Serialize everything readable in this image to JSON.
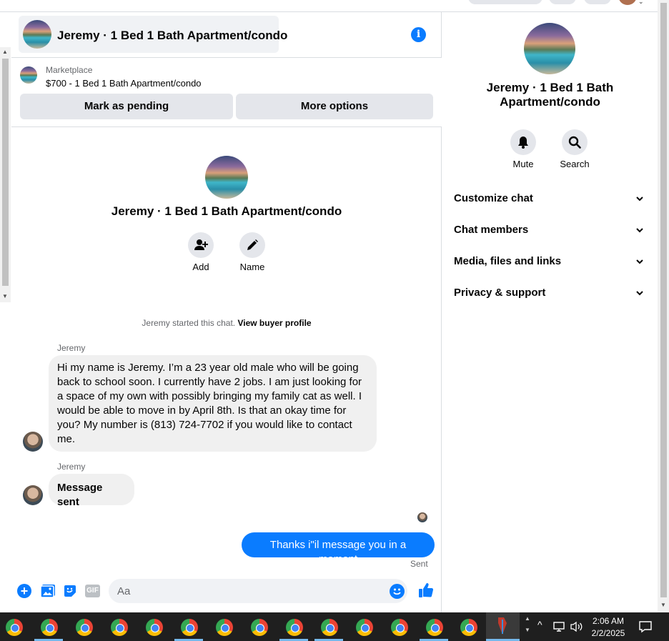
{
  "header": {
    "title": "Jeremy · 1 Bed 1 Bath Apartment/condo"
  },
  "marketplace": {
    "label": "Marketplace",
    "listing": "$700 - 1 Bed 1 Bath Apartment/condo",
    "mark_pending": "Mark as pending",
    "more_options": "More options"
  },
  "intro": {
    "name": "Jeremy · 1 Bed 1 Bath Apartment/condo",
    "add_label": "Add",
    "name_label": "Name",
    "started_text": "Jeremy started this chat.",
    "view_profile": "View buyer profile"
  },
  "messages": [
    {
      "sender": "Jeremy",
      "text": "Hi my name is Jeremy. I’m a 23 year old male who will be going back to school soon. I currently have 2 jobs. I am just looking for a space of my own with possibly bringing my family cat as well. I would be able to move in by April 8th. Is that an okay time for you? My number is (813) 724-7702 if you would like to contact me."
    },
    {
      "sender": "Jeremy",
      "text": "Message sent"
    },
    {
      "sender": "me",
      "text": "Thanks i\"il message you in a moment",
      "status": "Sent"
    }
  ],
  "composer": {
    "placeholder": "Aa"
  },
  "right_panel": {
    "name": "Jeremy · 1 Bed 1 Bath Apartment/condo",
    "mute_label": "Mute",
    "search_label": "Search",
    "sections": [
      "Customize chat",
      "Chat members",
      "Media, files and links",
      "Privacy & support"
    ]
  },
  "taskbar": {
    "time": "2:06 AM",
    "date": "2/2/2025"
  },
  "colors": {
    "accent": "#0a7cff",
    "bubble_in": "#f0f0f0",
    "button_gray": "#e4e6eb",
    "taskbar": "#1f1f1f"
  }
}
